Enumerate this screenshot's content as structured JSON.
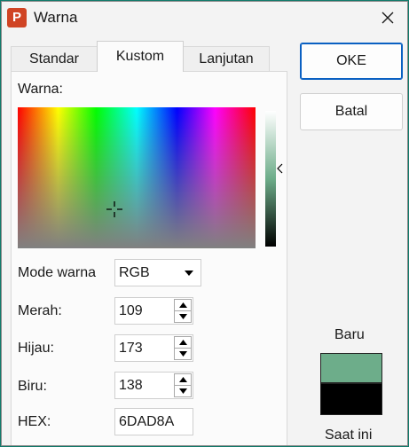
{
  "window": {
    "title": "Warna",
    "app_icon_letter": "P"
  },
  "tabs": [
    {
      "label": "Standar",
      "active": false
    },
    {
      "label": "Kustom",
      "active": true
    },
    {
      "label": "Lanjutan",
      "active": false
    }
  ],
  "custom": {
    "colors_label": "Warna:",
    "mode_label": "Mode warna",
    "mode_value": "RGB",
    "red_label": "Merah:",
    "red_value": "109",
    "green_label": "Hijau:",
    "green_value": "173",
    "blue_label": "Biru:",
    "blue_value": "138",
    "hex_label": "HEX:",
    "hex_value": "6DAD8A"
  },
  "buttons": {
    "ok": "OKE",
    "cancel": "Batal"
  },
  "preview": {
    "new_label": "Baru",
    "current_label": "Saat ini",
    "new_color": "#6DAD8A",
    "current_color": "#000000"
  },
  "colors": {
    "accent": "#0a60c2",
    "app_icon": "#d04424"
  }
}
